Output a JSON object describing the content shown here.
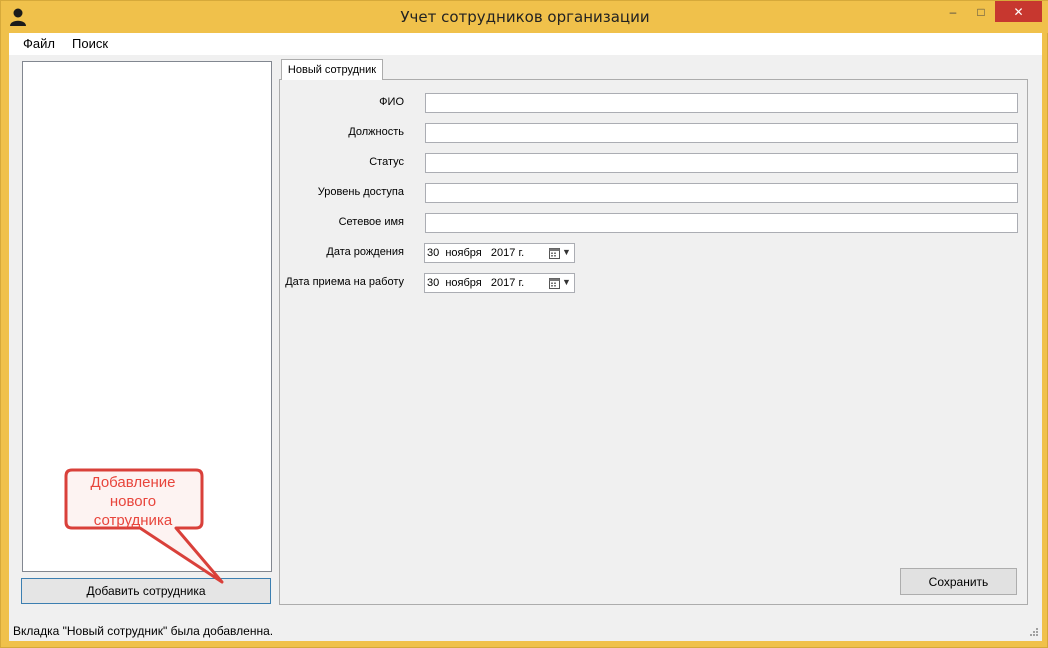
{
  "window": {
    "title": "Учет сотрудников организации",
    "controls": {
      "minimize": "‒",
      "maximize": "□",
      "close": "✕"
    },
    "app_icon": "user-icon"
  },
  "menu": {
    "file": "Файл",
    "search": "Поиск"
  },
  "sidebar": {
    "add_button_label": "Добавить сотрудника"
  },
  "tab": {
    "label": "Новый сотрудник"
  },
  "form": {
    "fio_label": "ФИО",
    "position_label": "Должность",
    "status_label": "Статус",
    "access_level_label": "Уровень доступа",
    "network_name_label": "Сетевое имя",
    "birth_date_label": "Дата рождения",
    "birth_date_value": "30  ноября   2017 г.",
    "hire_date_label": "Дата приема на работу",
    "hire_date_value": "30  ноября   2017 г.",
    "save_label": "Сохранить"
  },
  "callout": {
    "line1": "Добавление",
    "line2": "нового",
    "line3": "сотрудника",
    "color": "#e8453c"
  },
  "status": {
    "text": "Вкладка \"Новый сотрудник\" была добавленна."
  },
  "colors": {
    "title_bar": "#f0c14b",
    "close_button": "#c7372f",
    "accent_border": "#3c7fb1"
  }
}
